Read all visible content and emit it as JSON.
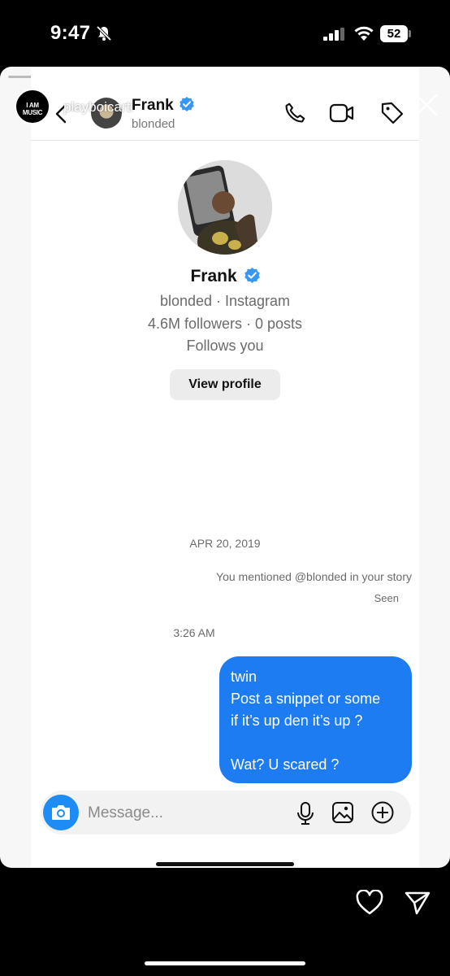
{
  "status_bar": {
    "time": "9:47",
    "battery": "52",
    "icons": [
      "bell-slash-icon",
      "cellular-signal-icon",
      "wifi-icon",
      "battery-icon"
    ]
  },
  "story": {
    "owner_name": "playboicarti",
    "owner_logo_text": "I AM MUSIC",
    "time_ago": "...",
    "segments": 6,
    "icons": [
      "close-icon",
      "heart-icon",
      "send-icon"
    ]
  },
  "dm": {
    "header": {
      "name": "Frank",
      "subtitle": "blonded",
      "icons": [
        "back-icon",
        "phone-icon",
        "video-icon",
        "tag-icon"
      ]
    },
    "profile": {
      "name": "Frank",
      "line1": "blonded · Instagram",
      "line2": "4.6M followers · 0 posts",
      "line3": "Follows you",
      "view_profile_label": "View profile"
    },
    "thread": {
      "date": "APR 20, 2019",
      "mention_note": "You mentioned @blonded in your story",
      "seen": "Seen",
      "time": "3:26 AM",
      "message_lines": [
        "twin",
        "Post a snippet or some",
        "if it’s up den it’s up ?",
        "",
        "Wat? U scared ?"
      ]
    },
    "composer": {
      "placeholder": "Message...",
      "icons": [
        "camera-icon",
        "microphone-icon",
        "gallery-icon",
        "add-icon"
      ]
    }
  },
  "colors": {
    "accent_blue": "#1d7cf2",
    "verified_blue": "#3897f0",
    "background": "#000000"
  }
}
